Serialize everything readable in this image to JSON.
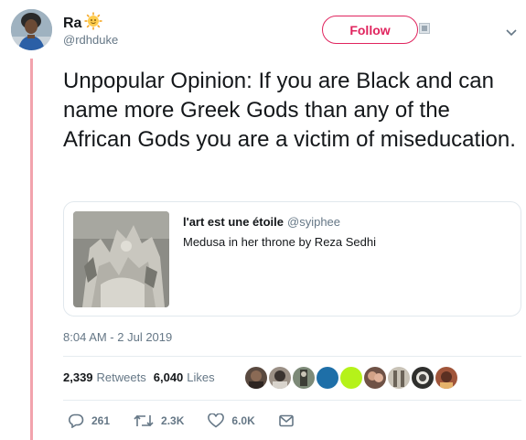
{
  "author": {
    "name": "Ra",
    "handle": "@rdhduke",
    "avatar_icon": "profile-avatar",
    "name_emoji": "sun-face-icon"
  },
  "follow_button": {
    "label": "Follow",
    "color": "#e0245e"
  },
  "tweet": {
    "text": "Unpopular Opinion: If you are Black and can name more Greek Gods than any of the African Gods you are a victim of miseducation."
  },
  "quote": {
    "name": "l'art est une étoile",
    "handle": "@syiphee",
    "text": "Medusa in her throne by Reza Sedhi",
    "image_icon": "medusa-sculpture-image"
  },
  "timestamp": "8:04 AM - 2 Jul 2019",
  "stats": {
    "retweets_count": "2,339",
    "retweets_label": "Retweets",
    "likes_count": "6,040",
    "likes_label": "Likes"
  },
  "likers": [
    "liker-avatar-1",
    "liker-avatar-2",
    "liker-avatar-3",
    "liker-avatar-blue",
    "liker-avatar-green",
    "liker-avatar-6",
    "liker-avatar-7",
    "liker-avatar-8",
    "liker-avatar-9"
  ],
  "actions": {
    "replies": "261",
    "retweets": "2.3K",
    "likes": "6.0K"
  },
  "colors": {
    "thread_line": "#f2a3ad",
    "secondary_text": "#657786",
    "liker_blue": "#1e6fa8",
    "liker_green": "#b5f21a"
  }
}
